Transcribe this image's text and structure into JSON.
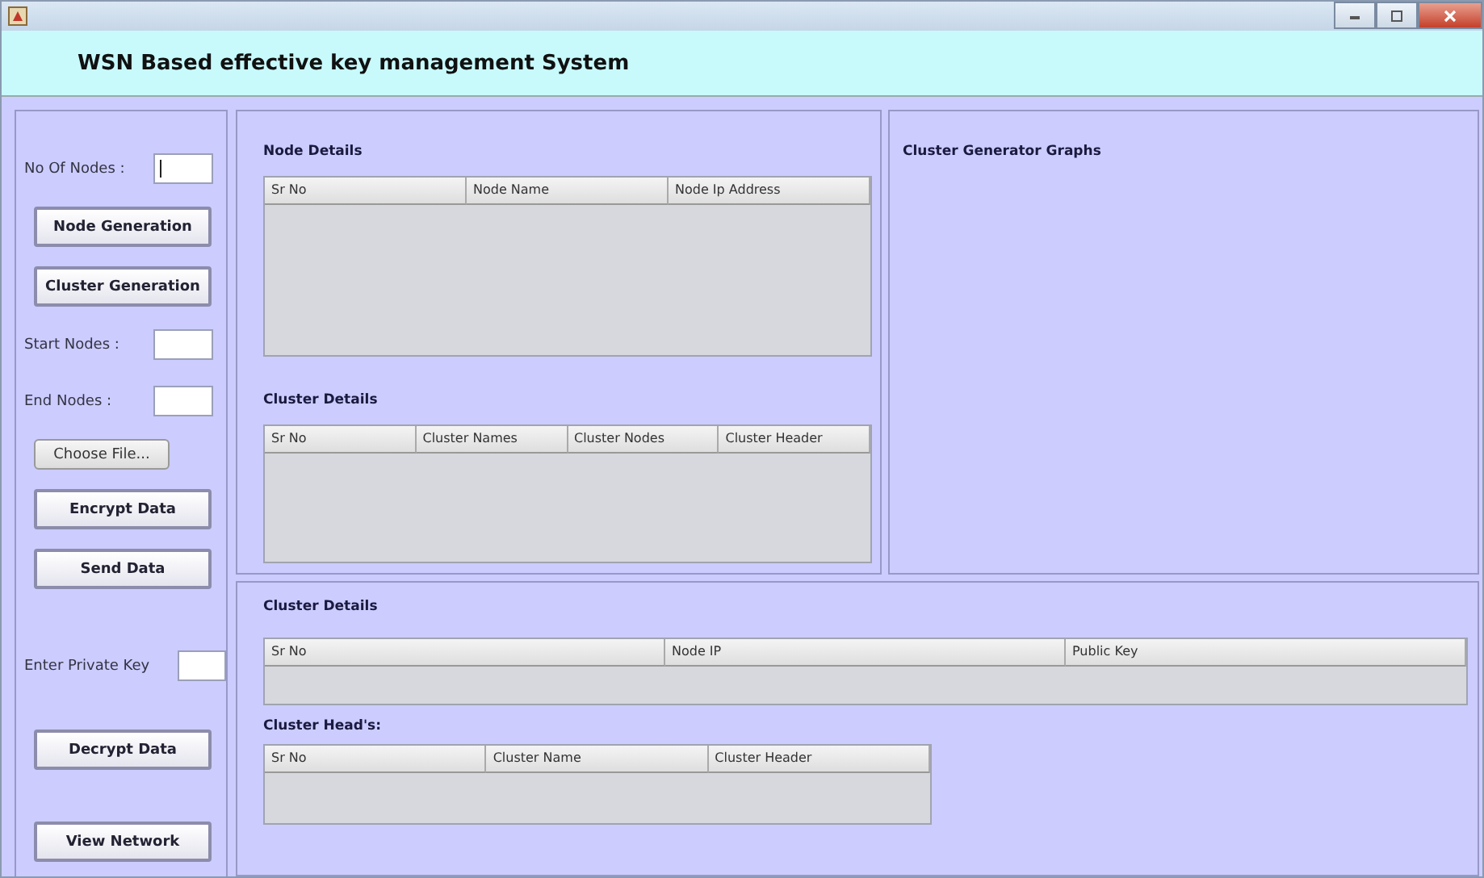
{
  "header": {
    "title": "WSN Based effective key management System"
  },
  "sidebar": {
    "items": [
      {
        "kind": "field",
        "label": "No Of Nodes :",
        "focused": true
      },
      {
        "kind": "button",
        "label": "Node Generation"
      },
      {
        "kind": "button",
        "label": "Cluster Generation"
      },
      {
        "kind": "field",
        "label": "Start Nodes :",
        "focused": false
      },
      {
        "kind": "field",
        "label": "End Nodes :",
        "focused": false
      },
      {
        "kind": "file",
        "label": "Choose File..."
      },
      {
        "kind": "button",
        "label": "Encrypt Data"
      },
      {
        "kind": "button",
        "label": "Send Data"
      },
      {
        "kind": "field",
        "label": "Enter Private Key",
        "focused": false
      },
      {
        "kind": "button",
        "label": "Decrypt Data"
      },
      {
        "kind": "button",
        "label": "View Network"
      }
    ]
  },
  "details_panel": {
    "sections": [
      {
        "title": "Node Details",
        "columns": [
          "Sr No",
          "Node Name",
          "Node Ip Address"
        ]
      },
      {
        "title": "Cluster Details",
        "columns": [
          "Sr No",
          "Cluster Names",
          "Cluster Nodes",
          "Cluster Header"
        ]
      }
    ]
  },
  "graph_panel": {
    "title": "Cluster Generator Graphs"
  },
  "key_panel": {
    "sections": [
      {
        "title": "Cluster Details",
        "columns": [
          "Sr No",
          "Node IP",
          "Public Key"
        ]
      },
      {
        "title": "Cluster Head's:",
        "columns": [
          "Sr No",
          "Cluster Name",
          "Cluster Header"
        ]
      }
    ]
  }
}
